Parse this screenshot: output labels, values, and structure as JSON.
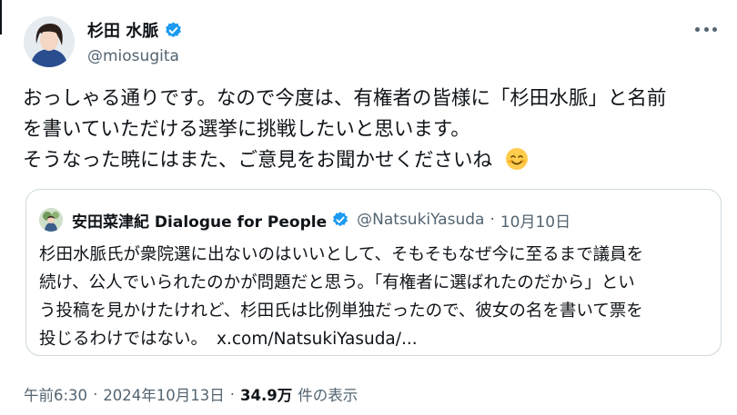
{
  "author": {
    "display_name": "杉田 水脈",
    "handle": "@miosugita"
  },
  "tweet": {
    "lines": [
      "おっしゃる通りです。なので今度は、有権者の皆様に「杉田水脈」と名前",
      "を書いていただける選挙に挑戦したいと思います。",
      "そうなった暁にはまた、ご意見をお聞かせくださいね"
    ],
    "emoji": "smiling-face-icon"
  },
  "quote": {
    "display_name": "安田菜津紀 Dialogue for People",
    "handle": "@NatsukiYasuda",
    "separator": "·",
    "date": "10月10日",
    "lines": [
      "杉田水脈氏が衆院選に出ないのはいいとして、そもそもなぜ今に至るまで議員を",
      "続け、公人でいられたのかが問題だと思う。「有権者に選ばれたのだから」とい",
      "う投稿を見かけたけれど、杉田氏は比例単独だったので、彼女の名を書いて票を",
      "投じるわけではない。"
    ],
    "link": "x.com/NatsukiYasuda/..."
  },
  "meta": {
    "time": "午前6:30",
    "dot1": "·",
    "date": "2024年10月13日",
    "dot2": "·",
    "views_count": "34.9万",
    "views_label": "件の表示"
  },
  "colors": {
    "verified_blue": "#1d9bf0",
    "secondary_text": "#536471",
    "border": "#cfd9de"
  }
}
